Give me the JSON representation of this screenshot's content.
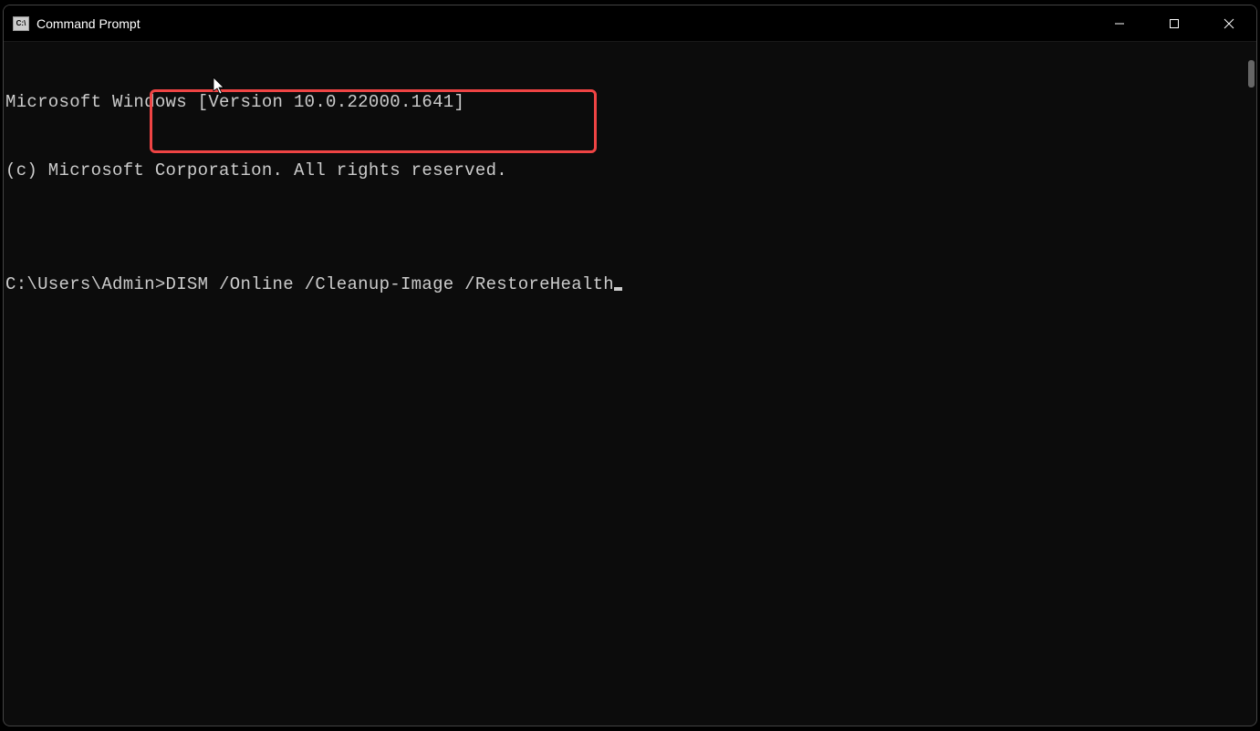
{
  "window": {
    "title": "Command Prompt",
    "icon_label": "C:\\"
  },
  "terminal": {
    "line1": "Microsoft Windows [Version 10.0.22000.1641]",
    "line2": "(c) Microsoft Corporation. All rights reserved.",
    "blank": "",
    "prompt": "C:\\Users\\Admin>",
    "command": "DISM /Online /Cleanup-Image /RestoreHealth"
  },
  "annotation": {
    "highlight_color": "#ef4444"
  }
}
